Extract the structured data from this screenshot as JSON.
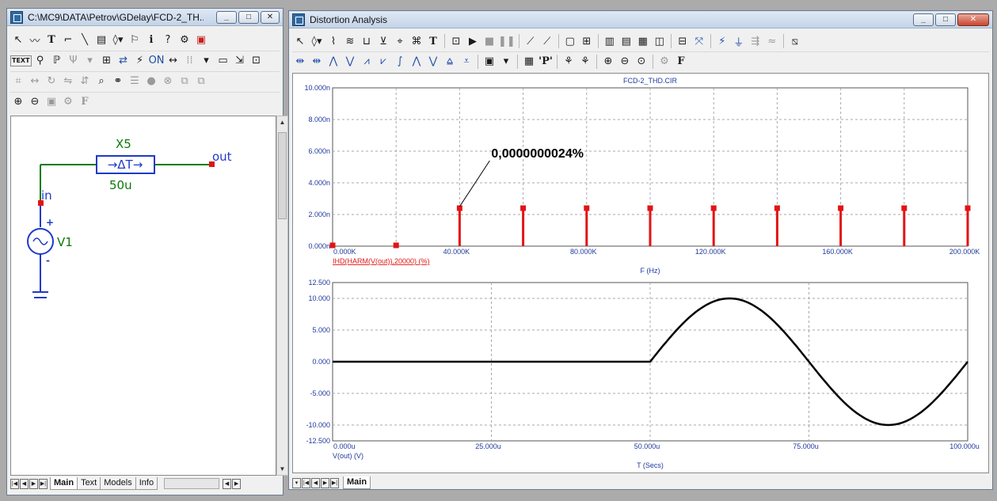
{
  "schematic_window": {
    "title": "C:\\MC9\\DATA\\Petrov\\GDelay\\FCD-2_TH...",
    "toolbar_row1": [
      "pointer-tool",
      "wire-tool",
      "text-tool",
      "wire-ortho-tool",
      "line-tool",
      "flag-tool",
      "component-tool",
      "flag2-tool",
      "info-tool",
      "help-tool",
      "gear-tool",
      "grid-tool"
    ],
    "toolbar_row2": [
      "text-label",
      "node-tool",
      "net-tool",
      "pin-tool",
      "dropdown",
      "box-tool",
      "swap-tool",
      "on-tool",
      "line2-tool",
      "dots-tool",
      "dropdown2",
      "window-tool",
      "select-tool",
      "props-tool"
    ],
    "toolbar_row3": [
      "grid-tool",
      "step-tool",
      "rotate-tool",
      "flip-h-tool",
      "flip-v-tool",
      "find-tool",
      "binoculars-tool",
      "list-tool",
      "stop-tool",
      "close-tool",
      "copy-tool",
      "paste-tool"
    ],
    "toolbar_row4": [
      "zoom-in",
      "zoom-out",
      "camera-tool",
      "gear-tool",
      "font-tool"
    ],
    "component": {
      "name": "X5",
      "value": "50u",
      "symbol": "→ΔT→"
    },
    "source": {
      "name": "V1",
      "plus": "+",
      "minus": "-"
    },
    "nodes": {
      "in": "in",
      "out": "out"
    },
    "tabs": [
      "Main",
      "Text",
      "Models",
      "Info"
    ],
    "active_tab": "Main",
    "colors": {
      "wire": "#0a7a0a",
      "component": "#1f3ac8",
      "node": "#e21414",
      "text_green": "#0a7a0a"
    }
  },
  "analysis_window": {
    "title": "Distortion Analysis",
    "tabs": [
      "Main"
    ],
    "top_plot": {
      "title": "FCD-2_THD.CIR",
      "y_ticks": [
        "10.000n",
        "8.000n",
        "6.000n",
        "4.000n",
        "2.000n",
        "0.000n"
      ],
      "x_ticks": [
        "0.000K",
        "40.000K",
        "80.000K",
        "120.000K",
        "160.000K",
        "200.000K"
      ],
      "xlabel": "F (Hz)",
      "trace_label": "IHD(HARM(V(out)),20000) (%)",
      "annotation": "0,0000000024%",
      "colors": {
        "trace": "#e21414",
        "grid": "#a9a9a9",
        "axis_text": "#1f3a9c"
      }
    },
    "bottom_plot": {
      "y_ticks": [
        "12.500",
        "10.000",
        "5.000",
        "0.000",
        "-5.000",
        "-10.000",
        "-12.500"
      ],
      "x_ticks": [
        "0.000u",
        "25.000u",
        "50.000u",
        "75.000u",
        "100.000u"
      ],
      "xlabel": "T (Secs)",
      "trace_label": "V(out) (V)",
      "colors": {
        "trace": "#000000"
      }
    }
  },
  "chart_data": [
    {
      "type": "bar",
      "title": "FCD-2_THD.CIR",
      "xlabel": "F (Hz)",
      "ylabel": "IHD(HARM(V(out)),20000) (%)",
      "x": [
        0,
        20000,
        40000,
        60000,
        80000,
        100000,
        120000,
        140000,
        160000,
        180000,
        200000
      ],
      "values": [
        0.05,
        0.05,
        2.4,
        2.4,
        2.4,
        2.4,
        2.4,
        2.4,
        2.4,
        2.4,
        2.4
      ],
      "yunit": "n",
      "xlim": [
        0,
        200000
      ],
      "ylim": [
        0,
        10
      ],
      "grid": true
    },
    {
      "type": "line",
      "xlabel": "T (Secs)",
      "ylabel": "V(out) (V)",
      "x": [
        0,
        5,
        10,
        15,
        20,
        25,
        30,
        35,
        40,
        45,
        50,
        52.5,
        55,
        57.5,
        60,
        62.5,
        65,
        67.5,
        70,
        72.5,
        75,
        77.5,
        80,
        82.5,
        85,
        87.5,
        90,
        92.5,
        95,
        97.5,
        100
      ],
      "y": [
        0,
        0,
        0,
        0,
        0,
        0,
        0,
        0,
        0,
        0,
        0,
        3.09,
        5.88,
        8.09,
        9.51,
        10,
        9.51,
        8.09,
        5.88,
        3.09,
        0,
        -3.09,
        -5.88,
        -8.09,
        -9.51,
        -10,
        -9.51,
        -8.09,
        -5.88,
        -3.09,
        0
      ],
      "xunit": "u",
      "xlim": [
        0,
        100
      ],
      "ylim": [
        -12.5,
        12.5
      ],
      "grid": true
    }
  ]
}
